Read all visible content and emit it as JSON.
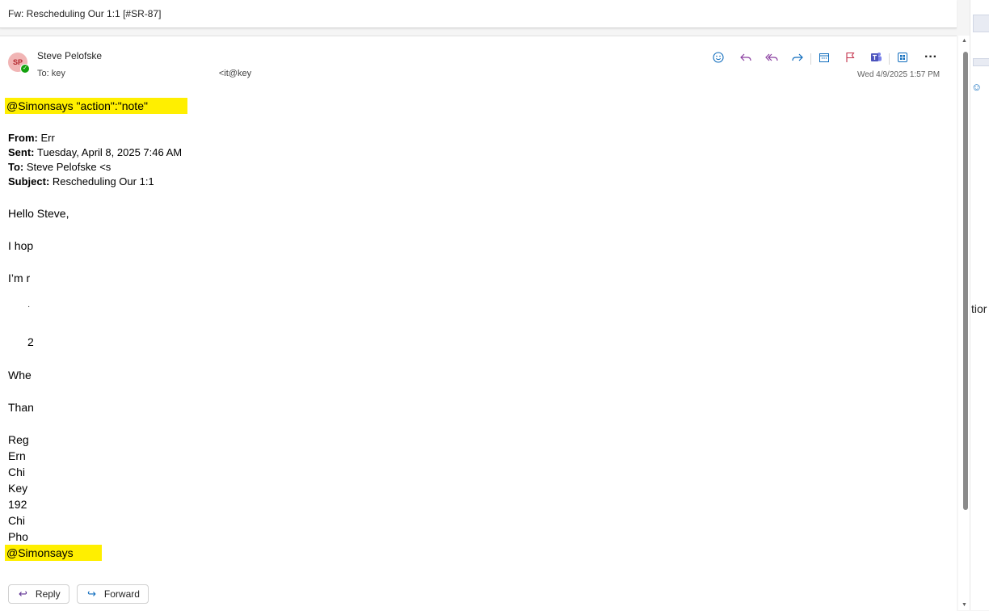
{
  "subject": "Fw: Rescheduling Our 1:1 [#SR-87]",
  "sender": {
    "initials": "SP",
    "name": "Steve Pelofske",
    "to_label": "To:",
    "to_part1": "key",
    "to_part2": "<it@key",
    "date": "Wed 4/9/2025 1:57 PM"
  },
  "toolbar": {
    "icons": [
      "emoji-icon",
      "reply-icon",
      "reply-all-icon",
      "forward-icon",
      "calendar-icon",
      "flag-icon",
      "teams-icon",
      "apps-icon",
      "more-icon"
    ]
  },
  "body": {
    "highlight_top": "@Simonsays \"action\":\"note\"",
    "from_label": "From:",
    "from_value": "Err",
    "sent_label": "Sent:",
    "sent_value": "Tuesday, April 8, 2025 7:46 AM",
    "to_label": "To:",
    "to_value": "Steve Pelofske <s",
    "subject_label": "Subject:",
    "subject_value": "Rescheduling Our 1:1",
    "greeting": "Hello Steve,",
    "line1": "I hop",
    "line2": "I’m r",
    "bullet1": "·",
    "bullet2": "2",
    "line3": "Whe",
    "line4": "Than",
    "sig1": "Reg",
    "sig2": "Ern",
    "sig3": "Chi",
    "sig4": "Key",
    "sig5": "192",
    "sig6": "Chi",
    "sig7": "Pho",
    "highlight_bottom": "@Simonsays"
  },
  "buttons": {
    "reply": "Reply",
    "forward": "Forward"
  },
  "right_panel": {
    "text": "tior"
  },
  "colors": {
    "highlight": "#ffef00",
    "accent": "#0f6cbd",
    "reply_icon": "#5c2e91"
  }
}
